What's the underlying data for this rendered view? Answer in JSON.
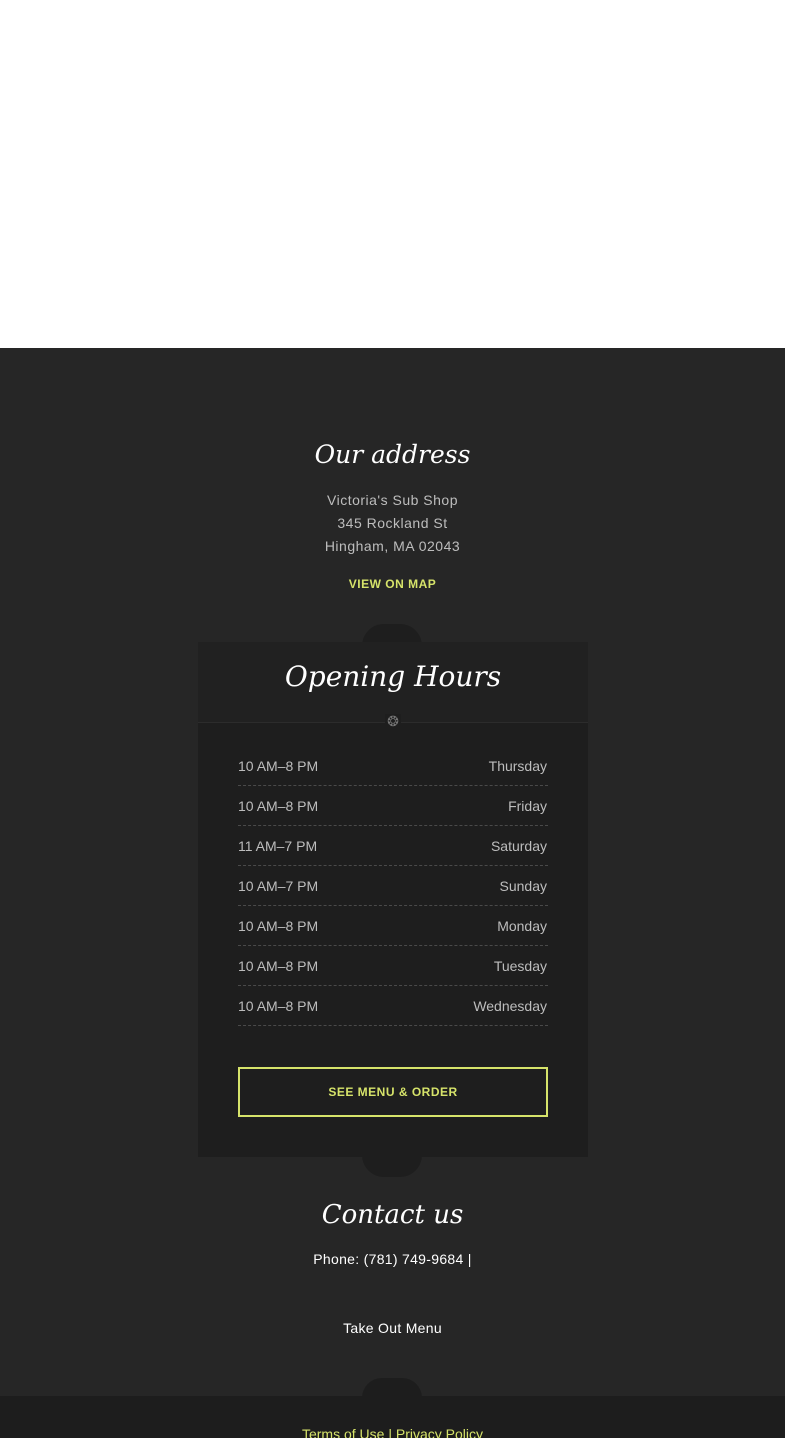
{
  "address": {
    "title": "Our address",
    "name": "Victoria's Sub Shop",
    "street": "345 Rockland St",
    "city": "Hingham, MA 02043",
    "map_link": "VIEW ON MAP"
  },
  "hours": {
    "title": "Opening Hours",
    "divider_icon": "ornament-icon",
    "rows": [
      {
        "time": "10 AM–8 PM",
        "day": "Thursday"
      },
      {
        "time": "10 AM–8 PM",
        "day": "Friday"
      },
      {
        "time": "11 AM–7 PM",
        "day": "Saturday"
      },
      {
        "time": "10 AM–7 PM",
        "day": "Sunday"
      },
      {
        "time": "10 AM–8 PM",
        "day": "Monday"
      },
      {
        "time": "10 AM–8 PM",
        "day": "Tuesday"
      },
      {
        "time": "10 AM–8 PM",
        "day": "Wednesday"
      }
    ],
    "order_button": "SEE MENU & ORDER"
  },
  "contact": {
    "title": "Contact us",
    "phone": "Phone: (781) 749-9684 |",
    "takeout_menu": "Take Out Menu"
  },
  "footer": {
    "terms": "Terms of Use",
    "separator": "|",
    "privacy": "Privacy Policy"
  },
  "colors": {
    "accent": "#d6e36a",
    "background": "#262626",
    "card": "#1e1e1e"
  }
}
